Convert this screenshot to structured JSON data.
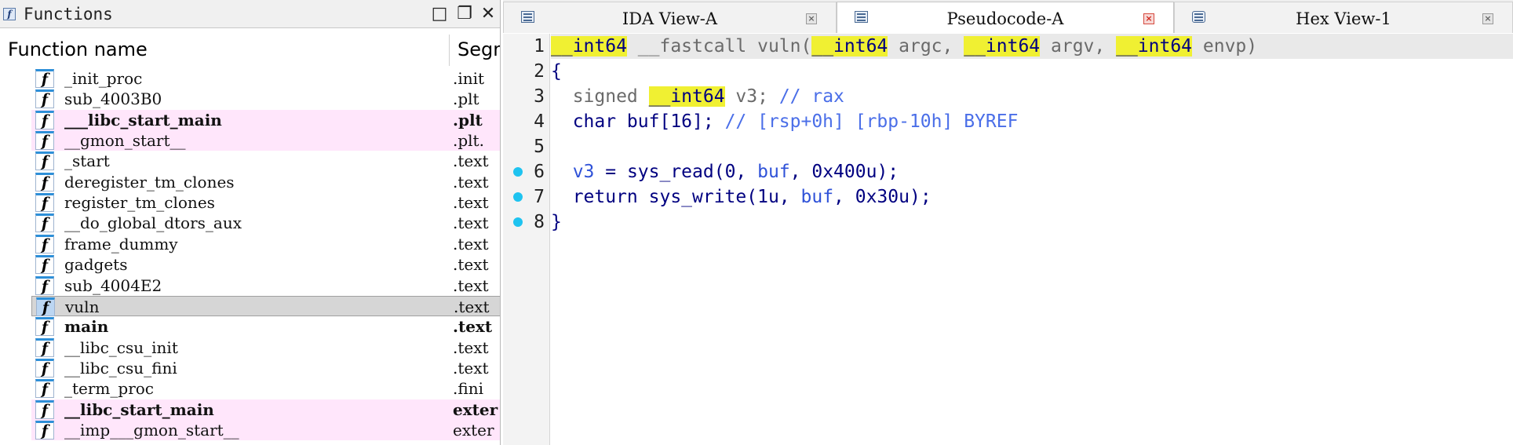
{
  "functions_window": {
    "title": "Functions",
    "col_name": "Function name",
    "col_segment": "Segm",
    "rows": [
      {
        "name": "_init_proc",
        "segment": ".init",
        "style": "normal"
      },
      {
        "name": "sub_4003B0",
        "segment": ".plt",
        "style": "normal"
      },
      {
        "name": "___libc_start_main",
        "segment": ".plt",
        "style": "pink-bold"
      },
      {
        "name": "__gmon_start__",
        "segment": ".plt.",
        "style": "pink"
      },
      {
        "name": "_start",
        "segment": ".text",
        "style": "normal"
      },
      {
        "name": "deregister_tm_clones",
        "segment": ".text",
        "style": "normal"
      },
      {
        "name": "register_tm_clones",
        "segment": ".text",
        "style": "normal"
      },
      {
        "name": "__do_global_dtors_aux",
        "segment": ".text",
        "style": "normal"
      },
      {
        "name": "frame_dummy",
        "segment": ".text",
        "style": "normal"
      },
      {
        "name": "gadgets",
        "segment": ".text",
        "style": "normal"
      },
      {
        "name": "sub_4004E2",
        "segment": ".text",
        "style": "normal"
      },
      {
        "name": "vuln",
        "segment": ".text",
        "style": "selected"
      },
      {
        "name": "main",
        "segment": ".text",
        "style": "bold"
      },
      {
        "name": "__libc_csu_init",
        "segment": ".text",
        "style": "normal"
      },
      {
        "name": "__libc_csu_fini",
        "segment": ".text",
        "style": "normal"
      },
      {
        "name": "_term_proc",
        "segment": ".fini",
        "style": "normal"
      },
      {
        "name": "__libc_start_main",
        "segment": "exter",
        "style": "pink-bold"
      },
      {
        "name": "__imp___gmon_start__",
        "segment": "exter",
        "style": "pink"
      }
    ]
  },
  "tabs": [
    {
      "label": "IDA View-A",
      "active": false
    },
    {
      "label": "Pseudocode-A",
      "active": true
    },
    {
      "label": "Hex View-1",
      "active": false
    }
  ],
  "pseudocode": {
    "line_numbers": [
      "1",
      "2",
      "3",
      "4",
      "5",
      "6",
      "7",
      "8"
    ],
    "breakpoint_lines": [
      6,
      7,
      8
    ],
    "lines": {
      "l1": {
        "t1": "__int64",
        "t2": " __fastcall vuln(",
        "t3": "__int64",
        "t4": " argc, ",
        "t5": "__int64",
        "t6": " argv, ",
        "t7": "__int64",
        "t8": " envp)"
      },
      "l2": {
        "t1": "{"
      },
      "l3": {
        "t1": "  signed ",
        "t2": "__int64",
        "t3": " v3; ",
        "t4": "// rax"
      },
      "l4": {
        "t1": "  char buf[16]; ",
        "t2": "// [rsp+0h] [rbp-10h] BYREF"
      },
      "l6": {
        "t1": "  ",
        "t2": "v3",
        "t3": " = sys_read(0, ",
        "t4": "buf",
        "t5": ", 0x400u);"
      },
      "l7": {
        "t1": "  return sys_write(1u, ",
        "t2": "buf",
        "t3": ", 0x30u);"
      },
      "l8": {
        "t1": "}"
      }
    },
    "colors": {
      "highlight": "#f0f032",
      "keyword": "#000080",
      "variable": "#2f52d8",
      "comment": "#4a6ee8",
      "breakpoint": "#1ec3f0"
    }
  }
}
